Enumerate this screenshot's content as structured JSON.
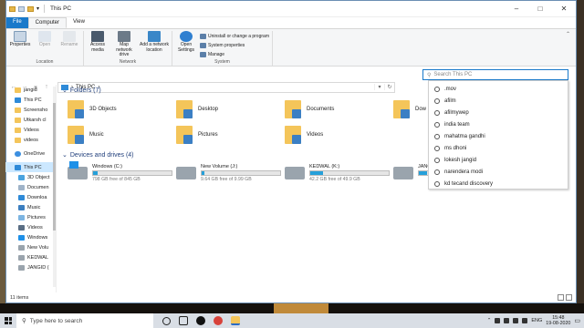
{
  "window": {
    "title": "This PC"
  },
  "ribbon_tabs": [
    "File",
    "Computer",
    "View"
  ],
  "ribbon": {
    "location": {
      "label": "Location",
      "buttons": [
        "Properties",
        "Open",
        "Rename"
      ]
    },
    "network": {
      "label": "Network",
      "buttons": [
        "Access media",
        "Map network drive",
        "Add a network location"
      ]
    },
    "system": {
      "label": "System",
      "open_settings": "Open Settings",
      "small": [
        "Uninstall or change a program",
        "System properties",
        "Manage"
      ]
    }
  },
  "address": {
    "path": "This PC"
  },
  "search": {
    "placeholder": "Search This PC"
  },
  "sidebar": {
    "items": [
      "jangid",
      "This PC",
      "Screensho",
      "Utkarsh cl",
      "Videos",
      "videos",
      "OneDrive",
      "This PC",
      "3D Object",
      "Documen",
      "Downloa",
      "Music",
      "Pictures",
      "Videos",
      "Windows",
      "New Volu",
      "KEDWAL",
      "JANGID ("
    ]
  },
  "folders": {
    "heading": "Folders (7)",
    "items": [
      "3D Objects",
      "Desktop",
      "Documents",
      "Dow",
      "Music",
      "Pictures",
      "Videos"
    ]
  },
  "drives": {
    "heading": "Devices and drives (4)",
    "items": [
      {
        "name": "Windows (C:)",
        "free": "798 GB free of 845 GB",
        "used_fraction": 0.06
      },
      {
        "name": "New Volume (J:)",
        "free": "9.64 GB free of 9.99 GB",
        "used_fraction": 0.04
      },
      {
        "name": "KEDWAL (K:)",
        "free": "42.2 GB free of 49.9 GB",
        "used_fraction": 0.16
      },
      {
        "name": "JANG",
        "free": "",
        "used_fraction": 0.1
      }
    ]
  },
  "suggestions": [
    ".mov",
    "afilm",
    "afilmywep",
    "india team",
    "mahatma gandhi",
    "ms dhoni",
    "lokesh jangid",
    "narendera modi",
    "kd tecand discovery"
  ],
  "status": {
    "count": "11 items"
  },
  "taskbar": {
    "search_placeholder": "Type here to search",
    "language": "ENG",
    "time": "15:48",
    "date": "19-08-2020"
  },
  "colors": {
    "accent": "#1979ca",
    "folder": "#f4c55a",
    "drive_bar": "#26a0da"
  }
}
